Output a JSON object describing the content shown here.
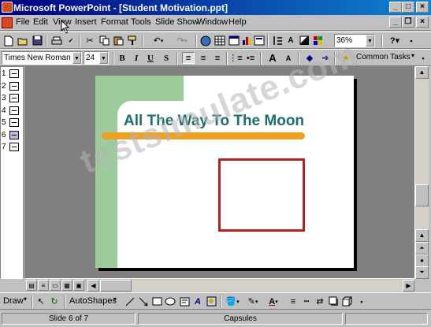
{
  "window": {
    "title": "Microsoft PowerPoint - [Student Motivation.ppt]"
  },
  "menus": [
    "File",
    "Edit",
    "View",
    "Insert",
    "Format",
    "Tools",
    "Slide Show",
    "Window",
    "Help"
  ],
  "formatting": {
    "font": "Times New Roman",
    "size": "24",
    "common_tasks": "Common Tasks",
    "zoom": "36%"
  },
  "outline": {
    "slide_numbers": [
      "1",
      "2",
      "3",
      "4",
      "5",
      "6",
      "7"
    ]
  },
  "slide": {
    "title": "All The Way To The Moon"
  },
  "drawing": {
    "draw_label": "Draw",
    "autoshapes_label": "AutoShapes"
  },
  "status": {
    "slide_position": "Slide 6 of 7",
    "design": "Capsules"
  },
  "watermark": "testsimulate.com",
  "colors": {
    "title_bar": "#000080",
    "slide_title": "#1f6e6e",
    "orange_bar": "#f0a020",
    "green_band": "#9ccc9c",
    "frame": "#b22222"
  }
}
